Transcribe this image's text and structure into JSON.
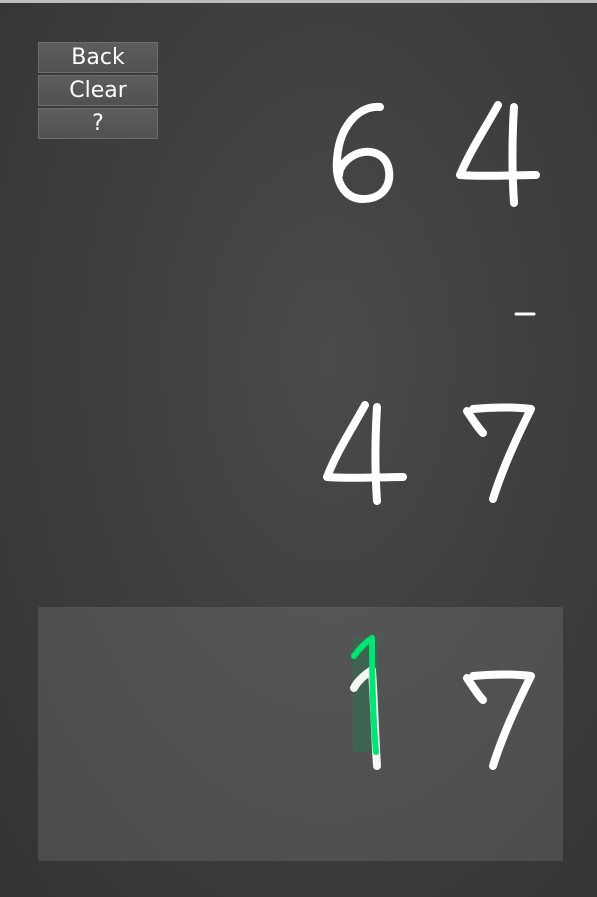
{
  "buttons": {
    "back": "Back",
    "clear": "Clear",
    "help": "?"
  },
  "problem": {
    "operation": "subtraction",
    "top_number": [
      6,
      4
    ],
    "bottom_number": [
      4,
      7
    ],
    "answer_entered": [
      1,
      7
    ],
    "answer_handwritten_digit": 1
  },
  "colors": {
    "digit": "#ffffff",
    "handwriting": "#00e676",
    "hint": "#2e8a5a"
  }
}
